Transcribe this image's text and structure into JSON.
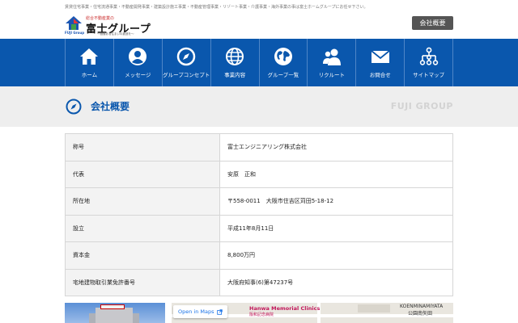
{
  "header": {
    "tagline": "賃貸住宅事業・住宅流通事業・不動産開発事業・建築設計施工事業・不動産管理事業・リゾート事業・介護事業・海外事業の事は富士ホームグループにお任せ下さい。",
    "logo_sub": "総合不動産業の",
    "logo_main": "富士グループ",
    "logo_en": "FUJI Group",
    "logo_tag": "〜価値ある住まいの創造を〜",
    "company_button": "会社概要"
  },
  "nav": {
    "items": [
      {
        "label": "ホーム",
        "icon": "home-icon"
      },
      {
        "label": "メッセージ",
        "icon": "person-icon"
      },
      {
        "label": "グループコンセプト",
        "icon": "compass-icon"
      },
      {
        "label": "事業内容",
        "icon": "globe-grid-icon"
      },
      {
        "label": "グループ一覧",
        "icon": "globe-icon"
      },
      {
        "label": "リクルート",
        "icon": "users-icon"
      },
      {
        "label": "お問合せ",
        "icon": "mail-icon"
      },
      {
        "label": "サイトマップ",
        "icon": "sitemap-icon"
      }
    ]
  },
  "page": {
    "title": "会社概要",
    "title_en": "FUJI GROUP"
  },
  "info_table": {
    "rows": [
      {
        "label": "称号",
        "value": "富士エンジニアリング株式会社"
      },
      {
        "label": "代表",
        "value": "安原　正和"
      },
      {
        "label": "所在地",
        "value": "〒558-0011　大阪市住吉区苅田5-18-12"
      },
      {
        "label": "設立",
        "value": "平成11年8月11日"
      },
      {
        "label": "資本金",
        "value": "8,800万円"
      },
      {
        "label": "宅地建物取引業免許番号",
        "value": "大阪府知事(6)第47237号"
      }
    ]
  },
  "map": {
    "open_label": "Open in Maps",
    "place1": "Hanwa Memorial Clinics",
    "place1_jp": "阪和記念病院",
    "place2": "KOENMINAMIYATA",
    "place2_jp": "公園南矢田"
  },
  "colors": {
    "nav_bg": "#0a57ad",
    "title_color": "#0a57ad",
    "button_bg": "#555555"
  }
}
